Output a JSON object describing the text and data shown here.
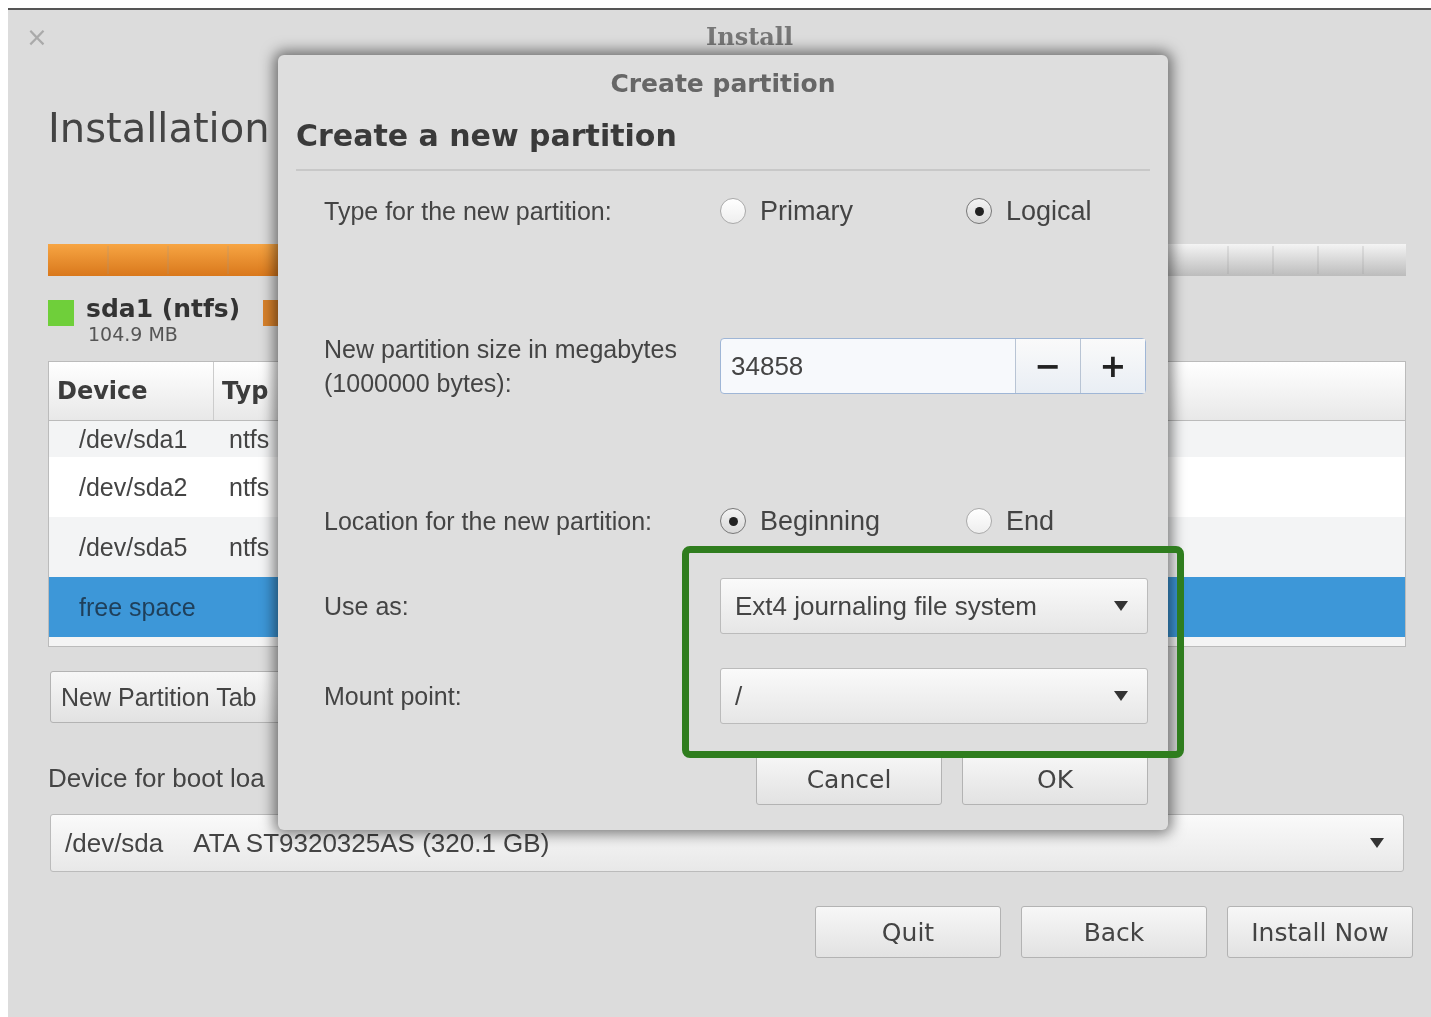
{
  "window": {
    "title": "Install",
    "close_glyph": "×"
  },
  "heading": "Installation",
  "legend": [
    {
      "name": "sda1 (ntfs)",
      "size": "104.9 MB",
      "color": "#6fcf3a"
    },
    {
      "color": "#d9822b"
    }
  ],
  "table": {
    "columns": [
      "Device",
      "Typ"
    ],
    "rows": [
      {
        "cells": [
          "/dev/sda1",
          "ntfs"
        ],
        "selected": false
      },
      {
        "cells": [
          "/dev/sda2",
          "ntfs"
        ],
        "selected": false
      },
      {
        "cells": [
          "/dev/sda5",
          "ntfs"
        ],
        "selected": false
      },
      {
        "cells": [
          "free space"
        ],
        "selected": true
      }
    ]
  },
  "new_partition_table_button": "New Partition Tab",
  "bootloader": {
    "label": "Device for boot loa",
    "value": "/dev/sda",
    "description": "ATA ST9320325AS (320.1 GB)"
  },
  "buttons": [
    "Quit",
    "Back",
    "Install Now"
  ],
  "dialog": {
    "title": "Create partition",
    "heading": "Create a new partition",
    "type": {
      "label": "Type for the new partition:",
      "options": [
        {
          "label": "Primary",
          "selected": false
        },
        {
          "label": "Logical",
          "selected": true
        }
      ]
    },
    "size": {
      "label": "New partition size in megabytes (1000000 bytes):",
      "value": "34858",
      "decrement": "−",
      "increment": "+"
    },
    "location": {
      "label": "Location for the new partition:",
      "options": [
        {
          "label": "Beginning",
          "selected": true
        },
        {
          "label": "End",
          "selected": false
        }
      ]
    },
    "use_as": {
      "label": "Use as:",
      "value": "Ext4 journaling file system"
    },
    "mount_point": {
      "label": "Mount point:",
      "value": "/"
    },
    "buttons": [
      "Cancel",
      "OK"
    ]
  }
}
